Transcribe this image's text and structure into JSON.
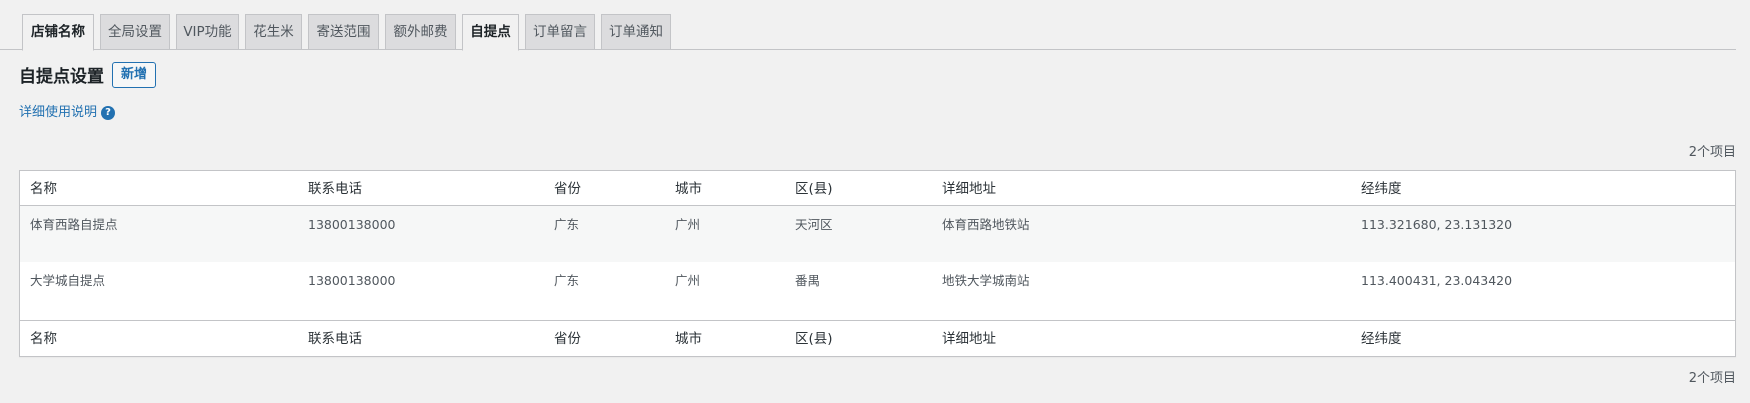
{
  "tabs": [
    {
      "label": "店铺名称",
      "active": false
    },
    {
      "label": "全局设置",
      "active": false
    },
    {
      "label": "VIP功能",
      "active": false
    },
    {
      "label": "花生米",
      "active": false
    },
    {
      "label": "寄送范围",
      "active": false
    },
    {
      "label": "额外邮费",
      "active": false
    },
    {
      "label": "自提点",
      "active": true
    },
    {
      "label": "订单留言",
      "active": false
    },
    {
      "label": "订单通知",
      "active": false
    }
  ],
  "header": {
    "title": "自提点设置",
    "add_label": "新增"
  },
  "help": {
    "link_label": "详细使用说明",
    "icon_glyph": "?"
  },
  "item_count": "2个项目",
  "table": {
    "columns": [
      "名称",
      "联系电话",
      "省份",
      "城市",
      "区(县)",
      "详细地址",
      "经纬度"
    ],
    "rows": [
      [
        "体育西路自提点",
        "13800138000",
        "广东",
        "广州",
        "天河区",
        "体育西路地铁站",
        "113.321680, 23.131320"
      ],
      [
        "大学城自提点",
        "13800138000",
        "广东",
        "广州",
        "番禺",
        "地铁大学城南站",
        "113.400431, 23.043420"
      ]
    ]
  },
  "colors": {
    "accent": "#2271b1",
    "background": "#f1f1f1",
    "tab_inactive": "#dcdcde"
  }
}
